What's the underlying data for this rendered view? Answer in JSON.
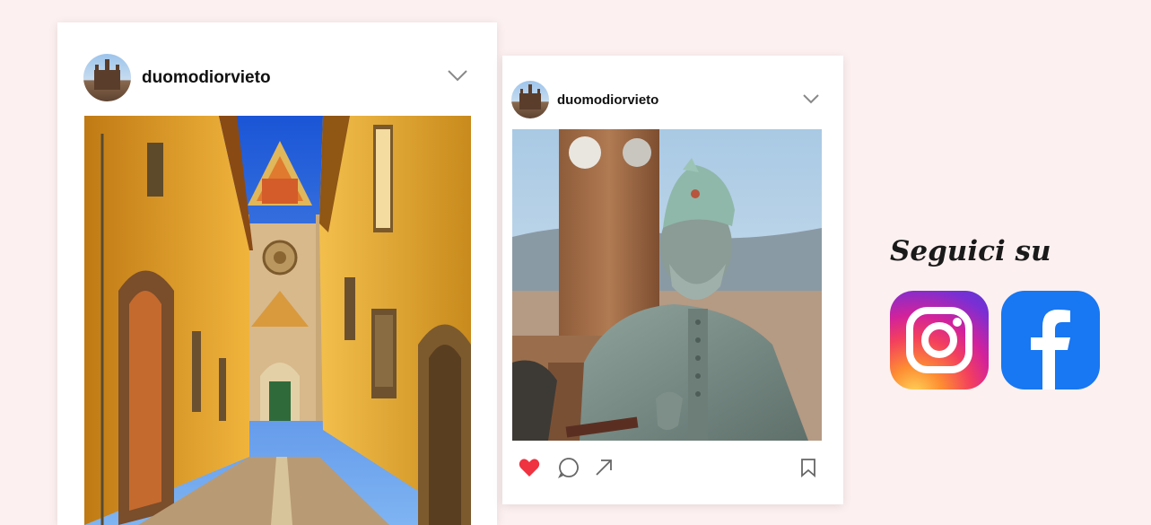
{
  "posts": [
    {
      "username": "duomodiorvieto"
    },
    {
      "username": "duomodiorvieto"
    }
  ],
  "follow": {
    "label": "Seguici su"
  },
  "icons": {
    "dropdown": "chevron-down-icon",
    "like": "heart-icon",
    "comment": "comment-icon",
    "share": "share-arrow-icon",
    "save": "bookmark-icon",
    "instagram": "instagram-icon",
    "facebook": "facebook-icon"
  },
  "colors": {
    "background": "#fdf0f0",
    "like": "#ef3340",
    "facebook": "#1877f2"
  }
}
